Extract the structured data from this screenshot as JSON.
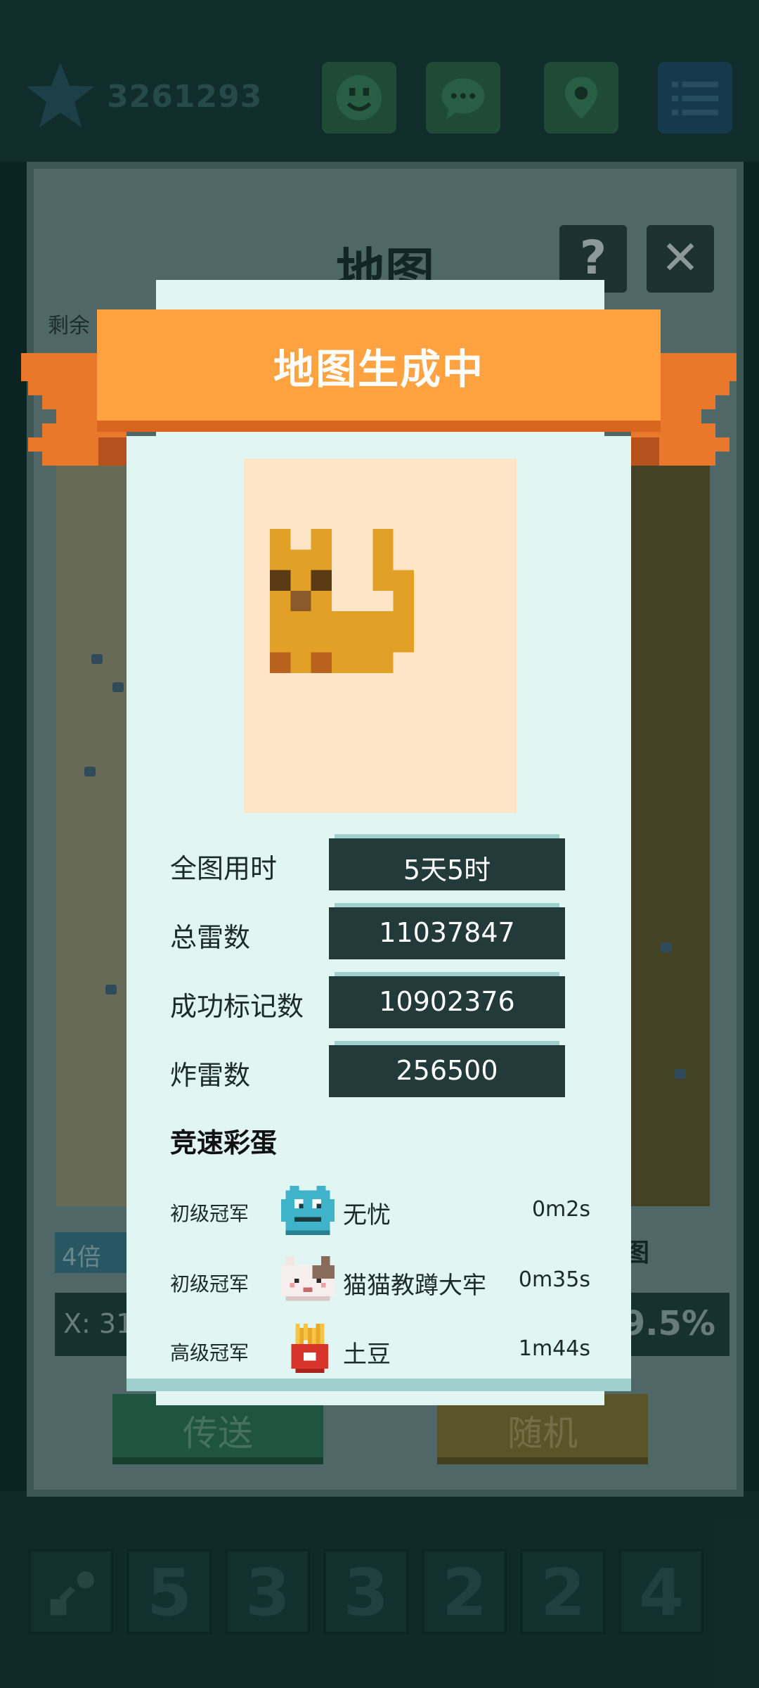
{
  "topbar": {
    "score": "3261293",
    "buttons": [
      "emoji-icon",
      "chat-icon",
      "location-icon",
      "menu-icon"
    ]
  },
  "map_panel": {
    "title": "地图",
    "help_symbol": "?",
    "close_symbol": "✕",
    "remaining_label": "剩余",
    "multiplier_label": "4倍",
    "coord_text": "X: 31",
    "right_label": "图",
    "percent_text": "9.5%",
    "teleport_label": "传送",
    "random_label": "随机"
  },
  "dialog": {
    "title": "地图生成中",
    "stats": [
      {
        "label": "全图用时",
        "value": "5天5时"
      },
      {
        "label": "总雷数",
        "value": "11037847"
      },
      {
        "label": "成功标记数",
        "value": "10902376"
      },
      {
        "label": "炸雷数",
        "value": "256500"
      }
    ],
    "section_title": "竞速彩蛋",
    "eggs": [
      {
        "rank": "初级冠军",
        "name": "无忧",
        "time": "0m2s",
        "avatar": "blue-monster-avatar"
      },
      {
        "rank": "初级冠军",
        "name": "猫猫教蹲大牢",
        "time": "0m35s",
        "avatar": "cat-avatar"
      },
      {
        "rank": "高级冠军",
        "name": "土豆",
        "time": "1m44s",
        "avatar": "fries-avatar"
      }
    ]
  },
  "board": {
    "numbers": [
      "5",
      "3",
      "3",
      "2",
      "2",
      "4"
    ]
  },
  "colors": {
    "ribbon": "#ffa23f",
    "dialog_bg": "#e1f5f3",
    "value_box": "#223b3a",
    "cat_fur": "#e3a027"
  }
}
